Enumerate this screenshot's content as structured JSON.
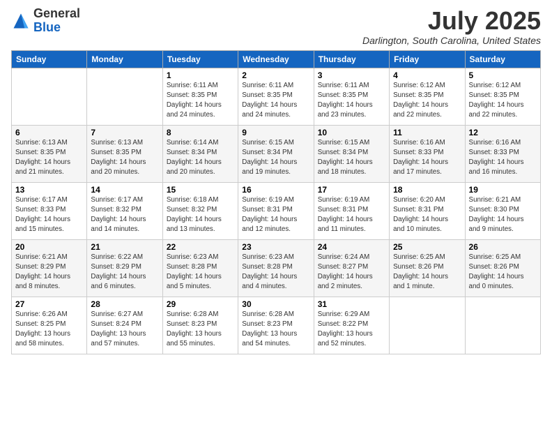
{
  "logo": {
    "general": "General",
    "blue": "Blue"
  },
  "header": {
    "month_year": "July 2025",
    "location": "Darlington, South Carolina, United States"
  },
  "days_of_week": [
    "Sunday",
    "Monday",
    "Tuesday",
    "Wednesday",
    "Thursday",
    "Friday",
    "Saturday"
  ],
  "weeks": [
    [
      {
        "day": "",
        "sunrise": "",
        "sunset": "",
        "daylight": ""
      },
      {
        "day": "",
        "sunrise": "",
        "sunset": "",
        "daylight": ""
      },
      {
        "day": "1",
        "sunrise": "Sunrise: 6:11 AM",
        "sunset": "Sunset: 8:35 PM",
        "daylight": "Daylight: 14 hours and 24 minutes."
      },
      {
        "day": "2",
        "sunrise": "Sunrise: 6:11 AM",
        "sunset": "Sunset: 8:35 PM",
        "daylight": "Daylight: 14 hours and 24 minutes."
      },
      {
        "day": "3",
        "sunrise": "Sunrise: 6:11 AM",
        "sunset": "Sunset: 8:35 PM",
        "daylight": "Daylight: 14 hours and 23 minutes."
      },
      {
        "day": "4",
        "sunrise": "Sunrise: 6:12 AM",
        "sunset": "Sunset: 8:35 PM",
        "daylight": "Daylight: 14 hours and 22 minutes."
      },
      {
        "day": "5",
        "sunrise": "Sunrise: 6:12 AM",
        "sunset": "Sunset: 8:35 PM",
        "daylight": "Daylight: 14 hours and 22 minutes."
      }
    ],
    [
      {
        "day": "6",
        "sunrise": "Sunrise: 6:13 AM",
        "sunset": "Sunset: 8:35 PM",
        "daylight": "Daylight: 14 hours and 21 minutes."
      },
      {
        "day": "7",
        "sunrise": "Sunrise: 6:13 AM",
        "sunset": "Sunset: 8:35 PM",
        "daylight": "Daylight: 14 hours and 20 minutes."
      },
      {
        "day": "8",
        "sunrise": "Sunrise: 6:14 AM",
        "sunset": "Sunset: 8:34 PM",
        "daylight": "Daylight: 14 hours and 20 minutes."
      },
      {
        "day": "9",
        "sunrise": "Sunrise: 6:15 AM",
        "sunset": "Sunset: 8:34 PM",
        "daylight": "Daylight: 14 hours and 19 minutes."
      },
      {
        "day": "10",
        "sunrise": "Sunrise: 6:15 AM",
        "sunset": "Sunset: 8:34 PM",
        "daylight": "Daylight: 14 hours and 18 minutes."
      },
      {
        "day": "11",
        "sunrise": "Sunrise: 6:16 AM",
        "sunset": "Sunset: 8:33 PM",
        "daylight": "Daylight: 14 hours and 17 minutes."
      },
      {
        "day": "12",
        "sunrise": "Sunrise: 6:16 AM",
        "sunset": "Sunset: 8:33 PM",
        "daylight": "Daylight: 14 hours and 16 minutes."
      }
    ],
    [
      {
        "day": "13",
        "sunrise": "Sunrise: 6:17 AM",
        "sunset": "Sunset: 8:33 PM",
        "daylight": "Daylight: 14 hours and 15 minutes."
      },
      {
        "day": "14",
        "sunrise": "Sunrise: 6:17 AM",
        "sunset": "Sunset: 8:32 PM",
        "daylight": "Daylight: 14 hours and 14 minutes."
      },
      {
        "day": "15",
        "sunrise": "Sunrise: 6:18 AM",
        "sunset": "Sunset: 8:32 PM",
        "daylight": "Daylight: 14 hours and 13 minutes."
      },
      {
        "day": "16",
        "sunrise": "Sunrise: 6:19 AM",
        "sunset": "Sunset: 8:31 PM",
        "daylight": "Daylight: 14 hours and 12 minutes."
      },
      {
        "day": "17",
        "sunrise": "Sunrise: 6:19 AM",
        "sunset": "Sunset: 8:31 PM",
        "daylight": "Daylight: 14 hours and 11 minutes."
      },
      {
        "day": "18",
        "sunrise": "Sunrise: 6:20 AM",
        "sunset": "Sunset: 8:31 PM",
        "daylight": "Daylight: 14 hours and 10 minutes."
      },
      {
        "day": "19",
        "sunrise": "Sunrise: 6:21 AM",
        "sunset": "Sunset: 8:30 PM",
        "daylight": "Daylight: 14 hours and 9 minutes."
      }
    ],
    [
      {
        "day": "20",
        "sunrise": "Sunrise: 6:21 AM",
        "sunset": "Sunset: 8:29 PM",
        "daylight": "Daylight: 14 hours and 8 minutes."
      },
      {
        "day": "21",
        "sunrise": "Sunrise: 6:22 AM",
        "sunset": "Sunset: 8:29 PM",
        "daylight": "Daylight: 14 hours and 6 minutes."
      },
      {
        "day": "22",
        "sunrise": "Sunrise: 6:23 AM",
        "sunset": "Sunset: 8:28 PM",
        "daylight": "Daylight: 14 hours and 5 minutes."
      },
      {
        "day": "23",
        "sunrise": "Sunrise: 6:23 AM",
        "sunset": "Sunset: 8:28 PM",
        "daylight": "Daylight: 14 hours and 4 minutes."
      },
      {
        "day": "24",
        "sunrise": "Sunrise: 6:24 AM",
        "sunset": "Sunset: 8:27 PM",
        "daylight": "Daylight: 14 hours and 2 minutes."
      },
      {
        "day": "25",
        "sunrise": "Sunrise: 6:25 AM",
        "sunset": "Sunset: 8:26 PM",
        "daylight": "Daylight: 14 hours and 1 minute."
      },
      {
        "day": "26",
        "sunrise": "Sunrise: 6:25 AM",
        "sunset": "Sunset: 8:26 PM",
        "daylight": "Daylight: 14 hours and 0 minutes."
      }
    ],
    [
      {
        "day": "27",
        "sunrise": "Sunrise: 6:26 AM",
        "sunset": "Sunset: 8:25 PM",
        "daylight": "Daylight: 13 hours and 58 minutes."
      },
      {
        "day": "28",
        "sunrise": "Sunrise: 6:27 AM",
        "sunset": "Sunset: 8:24 PM",
        "daylight": "Daylight: 13 hours and 57 minutes."
      },
      {
        "day": "29",
        "sunrise": "Sunrise: 6:28 AM",
        "sunset": "Sunset: 8:23 PM",
        "daylight": "Daylight: 13 hours and 55 minutes."
      },
      {
        "day": "30",
        "sunrise": "Sunrise: 6:28 AM",
        "sunset": "Sunset: 8:23 PM",
        "daylight": "Daylight: 13 hours and 54 minutes."
      },
      {
        "day": "31",
        "sunrise": "Sunrise: 6:29 AM",
        "sunset": "Sunset: 8:22 PM",
        "daylight": "Daylight: 13 hours and 52 minutes."
      },
      {
        "day": "",
        "sunrise": "",
        "sunset": "",
        "daylight": ""
      },
      {
        "day": "",
        "sunrise": "",
        "sunset": "",
        "daylight": ""
      }
    ]
  ]
}
